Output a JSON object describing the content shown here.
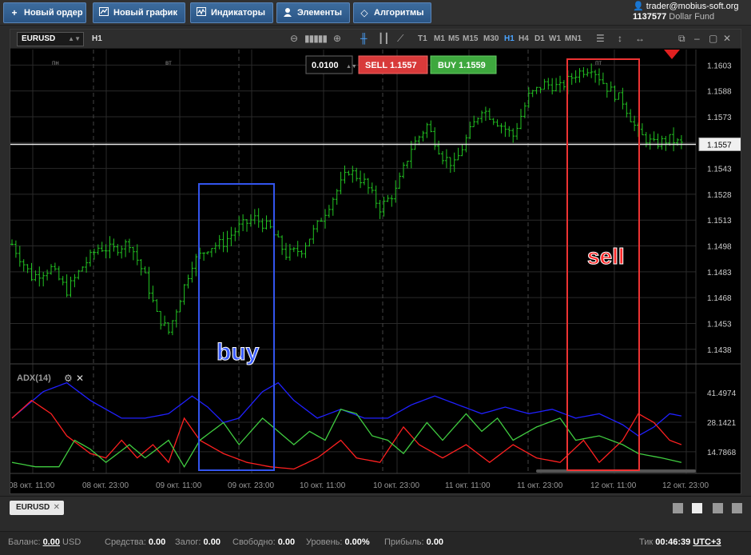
{
  "toolbar": {
    "new_order": "Новый ордер",
    "new_chart": "Новый график",
    "indicators": "Индикаторы",
    "elements": "Элементы",
    "algorithms": "Алгоритмы"
  },
  "account": {
    "user": "trader@mobius-soft.org",
    "number": "1137577",
    "fund": "Dollar Fund"
  },
  "chart_window": {
    "symbol": "EURUSD",
    "timeframe": "H1",
    "timeframes": [
      "T1",
      "M1",
      "M5",
      "M15",
      "M30",
      "H1",
      "H4",
      "D1",
      "W1",
      "MN1"
    ],
    "active_timeframe": "H1",
    "lot": "0.0100",
    "sell_label": "SELL",
    "sell_price": "1.1557",
    "buy_label": "BUY",
    "buy_price": "1.1559",
    "current_price": "1.1557",
    "indicator_label": "ADX(14)",
    "annotation_buy": "buy",
    "annotation_sell": "sell"
  },
  "chart_data": [
    {
      "type": "candlestick",
      "day_labels": [
        "пн",
        "вт",
        "пт"
      ],
      "y_ticks": [
        "1.1603",
        "1.1588",
        "1.1573",
        "1.1558",
        "1.1543",
        "1.1528",
        "1.1513",
        "1.1498",
        "1.1483",
        "1.1468",
        "1.1453",
        "1.1438"
      ],
      "ylim": [
        1.143,
        1.1612
      ],
      "x_ticks": [
        "08 окт. 11:00",
        "08 окт. 23:00",
        "09 окт. 11:00",
        "09 окт. 23:00",
        "10 окт. 11:00",
        "10 окт. 23:00",
        "11 окт. 11:00",
        "11 окт. 23:00",
        "12 окт. 11:00",
        "12 окт. 23:00"
      ],
      "current_price": 1.1557,
      "anchors": [
        [
          0,
          1.1499
        ],
        [
          5,
          1.148
        ],
        [
          10,
          1.1485
        ],
        [
          14,
          1.1472
        ],
        [
          18,
          1.1486
        ],
        [
          22,
          1.1497
        ],
        [
          26,
          1.1496
        ],
        [
          30,
          1.15
        ],
        [
          34,
          1.148
        ],
        [
          37,
          1.1458
        ],
        [
          40,
          1.1448
        ],
        [
          43,
          1.1468
        ],
        [
          46,
          1.1488
        ],
        [
          50,
          1.1497
        ],
        [
          54,
          1.15
        ],
        [
          58,
          1.1509
        ],
        [
          62,
          1.1514
        ],
        [
          66,
          1.1508
        ],
        [
          70,
          1.1493
        ],
        [
          74,
          1.1496
        ],
        [
          78,
          1.151
        ],
        [
          82,
          1.1526
        ],
        [
          86,
          1.1542
        ],
        [
          90,
          1.1535
        ],
        [
          94,
          1.152
        ],
        [
          98,
          1.153
        ],
        [
          102,
          1.1555
        ],
        [
          106,
          1.1568
        ],
        [
          110,
          1.155
        ],
        [
          113,
          1.1545
        ],
        [
          116,
          1.156
        ],
        [
          120,
          1.1578
        ],
        [
          124,
          1.157
        ],
        [
          128,
          1.1562
        ],
        [
          132,
          1.1585
        ],
        [
          136,
          1.1592
        ],
        [
          140,
          1.159
        ],
        [
          144,
          1.1598
        ],
        [
          148,
          1.1602
        ],
        [
          152,
          1.159
        ],
        [
          156,
          1.1582
        ],
        [
          160,
          1.1563
        ],
        [
          164,
          1.1557
        ],
        [
          168,
          1.156
        ],
        [
          171,
          1.1557
        ]
      ]
    },
    {
      "type": "line",
      "title": "ADX(14)",
      "y_ticks": [
        "41.4974",
        "28.1421",
        "14.7868"
      ],
      "ylim": [
        5,
        52
      ],
      "series": [
        {
          "color": "#2020ff",
          "anchors": [
            [
              0,
              30
            ],
            [
              8,
              42
            ],
            [
              14,
              46
            ],
            [
              20,
              38
            ],
            [
              28,
              30
            ],
            [
              34,
              30
            ],
            [
              40,
              32
            ],
            [
              46,
              40
            ],
            [
              50,
              35
            ],
            [
              54,
              28
            ],
            [
              58,
              30
            ],
            [
              64,
              42
            ],
            [
              68,
              46
            ],
            [
              72,
              38
            ],
            [
              78,
              30
            ],
            [
              84,
              34
            ],
            [
              90,
              30
            ],
            [
              96,
              30
            ],
            [
              102,
              36
            ],
            [
              108,
              40
            ],
            [
              114,
              36
            ],
            [
              120,
              32
            ],
            [
              126,
              35
            ],
            [
              132,
              32
            ],
            [
              138,
              34
            ],
            [
              144,
              30
            ],
            [
              150,
              32
            ],
            [
              156,
              27
            ],
            [
              160,
              22
            ],
            [
              164,
              26
            ],
            [
              168,
              32
            ],
            [
              171,
              31
            ]
          ]
        },
        {
          "color": "#ff2020",
          "anchors": [
            [
              0,
              30
            ],
            [
              5,
              38
            ],
            [
              10,
              32
            ],
            [
              14,
              22
            ],
            [
              20,
              14
            ],
            [
              24,
              12
            ],
            [
              28,
              20
            ],
            [
              32,
              12
            ],
            [
              36,
              18
            ],
            [
              40,
              10
            ],
            [
              44,
              30
            ],
            [
              48,
              20
            ],
            [
              54,
              14
            ],
            [
              60,
              10
            ],
            [
              66,
              8
            ],
            [
              72,
              7
            ],
            [
              78,
              12
            ],
            [
              84,
              20
            ],
            [
              88,
              12
            ],
            [
              94,
              10
            ],
            [
              100,
              26
            ],
            [
              104,
              18
            ],
            [
              110,
              12
            ],
            [
              116,
              18
            ],
            [
              122,
              10
            ],
            [
              128,
              18
            ],
            [
              134,
              12
            ],
            [
              140,
              10
            ],
            [
              146,
              20
            ],
            [
              150,
              10
            ],
            [
              156,
              20
            ],
            [
              160,
              32
            ],
            [
              164,
              28
            ],
            [
              168,
              20
            ],
            [
              171,
              18
            ]
          ]
        },
        {
          "color": "#40cc40",
          "anchors": [
            [
              0,
              10
            ],
            [
              6,
              8
            ],
            [
              12,
              8
            ],
            [
              16,
              20
            ],
            [
              20,
              16
            ],
            [
              24,
              10
            ],
            [
              30,
              18
            ],
            [
              34,
              12
            ],
            [
              40,
              20
            ],
            [
              44,
              8
            ],
            [
              48,
              20
            ],
            [
              54,
              28
            ],
            [
              58,
              18
            ],
            [
              64,
              30
            ],
            [
              68,
              24
            ],
            [
              72,
              18
            ],
            [
              76,
              24
            ],
            [
              80,
              20
            ],
            [
              84,
              34
            ],
            [
              88,
              32
            ],
            [
              92,
              22
            ],
            [
              96,
              20
            ],
            [
              100,
              14
            ],
            [
              106,
              28
            ],
            [
              110,
              20
            ],
            [
              116,
              32
            ],
            [
              120,
              24
            ],
            [
              124,
              30
            ],
            [
              128,
              20
            ],
            [
              134,
              26
            ],
            [
              140,
              30
            ],
            [
              144,
              20
            ],
            [
              150,
              22
            ],
            [
              156,
              18
            ],
            [
              160,
              14
            ],
            [
              166,
              12
            ],
            [
              171,
              10
            ]
          ]
        }
      ]
    }
  ]
}
